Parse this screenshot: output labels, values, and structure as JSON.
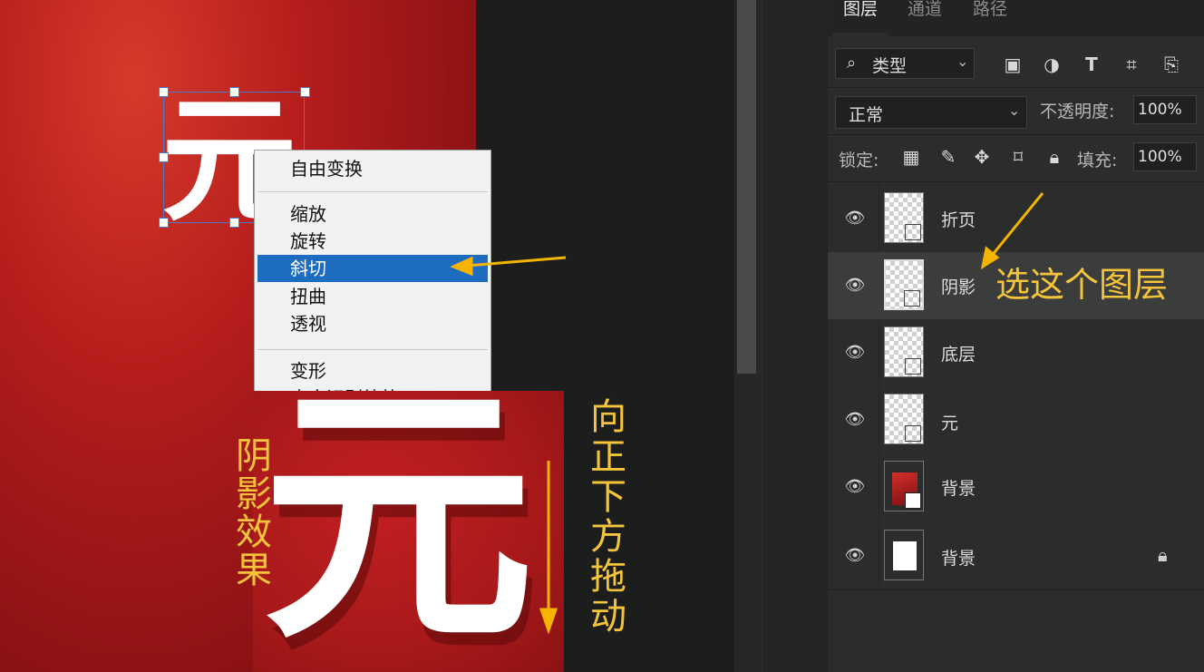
{
  "canvas": {
    "glyph": "元"
  },
  "context_menu": {
    "items": [
      "自由变换",
      "缩放",
      "旋转",
      "斜切",
      "扭曲",
      "透视",
      "变形",
      "内容识别缩放"
    ],
    "selected": "斜切"
  },
  "annotations": {
    "left_note": "阴影效果",
    "right_note": "向正下方拖动",
    "select_note": "选这个图层"
  },
  "preview": {
    "glyph": "元"
  },
  "layers_panel": {
    "tabs": [
      "图层",
      "通道",
      "路径"
    ],
    "active_tab": "图层",
    "filter": {
      "label": "类型",
      "icons": [
        "image-filter-icon",
        "adjustment-filter-icon",
        "type-filter-icon",
        "shape-filter-icon",
        "smartobject-filter-icon"
      ]
    },
    "blend_mode": "正常",
    "opacity_label": "不透明度:",
    "opacity_value": "100%",
    "lock_label": "锁定:",
    "fill_label": "填充:",
    "fill_value": "100%",
    "layers": [
      {
        "name": "折页",
        "selected": false
      },
      {
        "name": "阴影",
        "selected": true
      },
      {
        "name": "底层",
        "selected": false
      },
      {
        "name": "元",
        "selected": false
      },
      {
        "name": "背景",
        "selected": false,
        "thumb": "red-gradient"
      },
      {
        "name": "背景",
        "selected": false,
        "thumb": "white",
        "locked": true
      }
    ]
  },
  "colors": {
    "annotation": "#f4c43a",
    "menu_selection": "#1d6cc0",
    "transform_handle": "#4b78c8"
  }
}
